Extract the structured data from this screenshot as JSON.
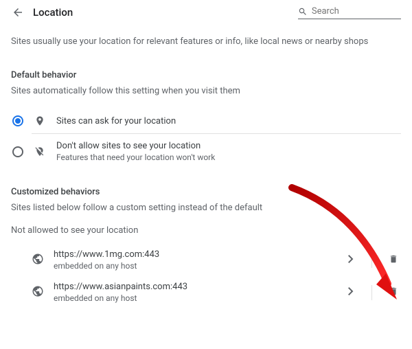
{
  "header": {
    "title": "Location",
    "search_placeholder": "Search"
  },
  "intro": "Sites usually use your location for relevant features or info, like local news or nearby shops",
  "behavior": {
    "title": "Default behavior",
    "sub": "Sites automatically follow this setting when you visit them",
    "options": [
      {
        "label": "Sites can ask for your location",
        "sub": ""
      },
      {
        "label": "Don't allow sites to see your location",
        "sub": "Features that need your location won't work"
      }
    ]
  },
  "custom": {
    "title": "Customized behaviors",
    "sub": "Sites listed below follow a custom setting instead of the default",
    "blocked_title": "Not allowed to see your location",
    "sites": [
      {
        "url": "https://www.1mg.com:443",
        "sub": "embedded on any host"
      },
      {
        "url": "https://www.asianpaints.com:443",
        "sub": "embedded on any host"
      }
    ]
  }
}
